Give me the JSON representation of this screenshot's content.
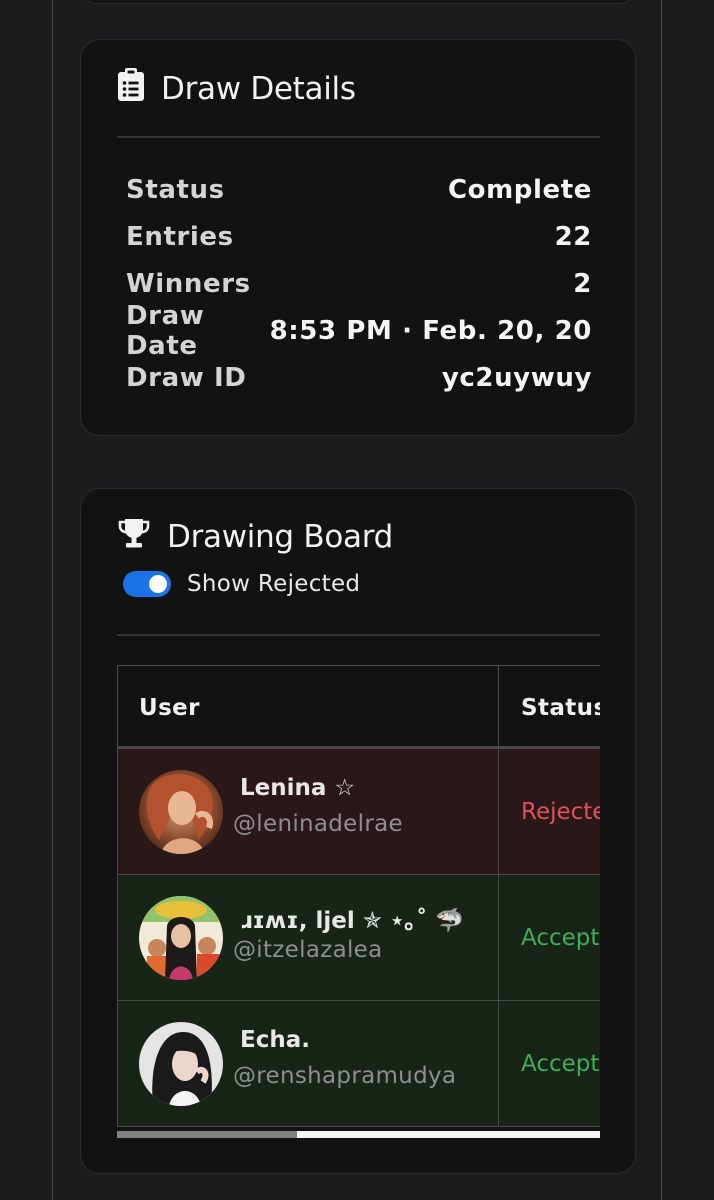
{
  "draw_details": {
    "title": "Draw Details",
    "rows": [
      {
        "label": "Status",
        "value": "Complete"
      },
      {
        "label": "Entries",
        "value": "22"
      },
      {
        "label": "Winners",
        "value": "2"
      },
      {
        "label": "Draw Date",
        "value": "8:53 PM · Feb. 20, 20"
      },
      {
        "label": "Draw ID",
        "value": "yc2uywuy"
      }
    ]
  },
  "drawing_board": {
    "title": "Drawing Board",
    "toggle": {
      "label": "Show Rejected",
      "on": true
    },
    "columns": [
      "User",
      "Status"
    ],
    "entries": [
      {
        "name": "Lenina ☆",
        "handle": "@leninadelrae",
        "status": "Rejected",
        "row_color": "#2a1818"
      },
      {
        "name": "ɹɪʍɪ, ljel ✯ ⋆｡˚ 🦈",
        "handle": "@itzelazalea",
        "status": "Accepted",
        "row_color": "#182418"
      },
      {
        "name": "Echa.",
        "handle": "@renshapramudya",
        "status": "Accepted",
        "row_color": "#182418"
      }
    ]
  },
  "colors": {
    "background": "#1c1c1e",
    "card": "#121212",
    "accent_blue": "#1a73e8",
    "rejected": "#e0505a",
    "accepted": "#3fae55"
  },
  "icons": {
    "details_icon": "clipboard-list-icon",
    "board_icon": "trophy-icon"
  }
}
